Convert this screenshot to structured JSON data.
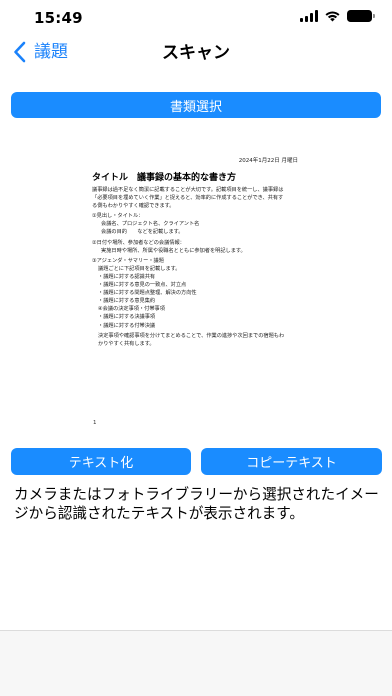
{
  "status_bar": {
    "time": "15:49"
  },
  "nav": {
    "back_label": "議題",
    "title": "スキャン"
  },
  "buttons": {
    "select_document": "書類選択",
    "ocr": "テキスト化",
    "copy_text": "コピーテキスト"
  },
  "document": {
    "date": "2024年1月22日 月曜日",
    "title": "タイトル　議事録の基本的な書き方",
    "lines": [
      "議事録は過不足なく簡潔に記載することが大切です。記載項目を統一し、議事録は",
      "「必要項目を埋めていく作業」と捉えると、効率的に作成することができ、共有す",
      "る側もわかりやすく確認できます。",
      "①見出し・タイトル：",
      "会議名、プロジェクト名、クライアント名",
      "会議の目的　　などを記載します。",
      "②日付や場所、参加者などの会議情報：",
      "実施日時や場所、所属や役職名とともに参加者を明記します。",
      "③アジェンダ・サマリー・議題",
      "議題ごとに下記項目を記載します。",
      "・議題に対する認識共有",
      "・議題に対する意見の一致点、対立点",
      "・議題に対する問題点整理、解決の方向性",
      "・議題に対する意見集約",
      "④会議の決定事項・付帯事項",
      "・議題に対する決議事項",
      "・議題に対する付帯決議",
      "決定事項や確認事項を分けてまとめることで、作業の進捗や次回までの宿題もわ",
      "かりやすく共有します。"
    ],
    "page_number": "1"
  },
  "result": {
    "text": "カメラまたはフォトライブラリーから選択されたイメージから認識されたテキストが表示されます。"
  },
  "colors": {
    "accent": "#1a8cff",
    "back_tint": "#1a82fb",
    "bottom_bar": "#f7f7f7"
  },
  "icons": {
    "back": "chevron-left-icon",
    "signal": "cellular-signal-icon",
    "wifi": "wifi-icon",
    "battery": "battery-icon"
  }
}
